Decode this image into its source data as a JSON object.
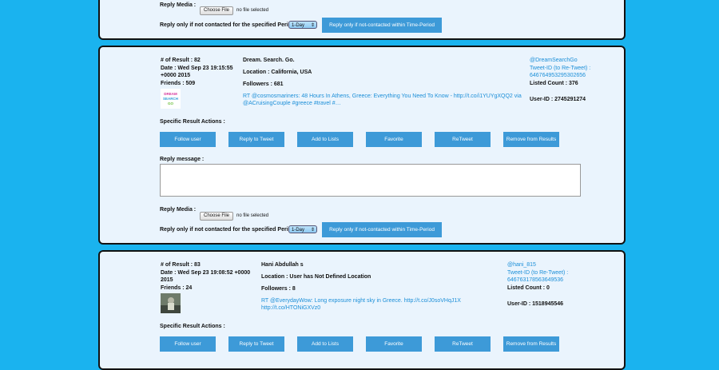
{
  "top": {
    "reply_media_label": "Reply Media :",
    "choose_file": "Choose File",
    "no_file": "no file selected",
    "period_label": "Reply only if not contacted for the specified Period :",
    "period_value": "1-Day",
    "period_button": "Reply only if not-contacted within Time-Period"
  },
  "results": [
    {
      "num": "# of Result : 82",
      "date_line1": "Date : Wed Sep 23 19:15:55",
      "date_line2": "+0000 2015",
      "friends": "Friends : 509",
      "avatar_text": "DREAM SEARCH GO",
      "name": "Dream. Search. Go.",
      "location": "Location : California, USA",
      "followers": "Followers : 681",
      "tweet_line1": "RT @cosmosmariners: 48 Hours In Athens, Greece: Everything You Need To Know - http://t.co/i1YUYgXQQ2 via",
      "tweet_line2": "@ACruisingCouple #greece #travel #…",
      "handle": "@DreamSearchGo",
      "tweet_id_label": "Tweet-ID (to Re-Tweet) :",
      "tweet_id": "646764953295302656",
      "listed": "Listed Count : 376",
      "user_id": "User-ID : 2745291274"
    },
    {
      "num": "# of Result : 83",
      "date_line1": "Date : Wed Sep 23 19:08:52 +0000",
      "date_line2": "2015",
      "friends": "Friends : 24",
      "name": "Hani Abdullah s",
      "location": "Location : User has Not Defined Location",
      "followers": "Followers : 8",
      "tweet_line1": "RT @EverydayWow: Long exposure night sky in Greece. http://t.co/J0soVHqJ1X",
      "tweet_line2": "http://t.co/HTONiGXVz0",
      "handle": "@hani_815",
      "tweet_id_label": "Tweet-ID (to Re-Tweet) :",
      "tweet_id": "646763178563649536",
      "listed": "Listed Count : 0",
      "user_id": "User-ID : 1518945546"
    }
  ],
  "actions_label": "Specific Result Actions :",
  "actions": {
    "follow": "Follow user",
    "reply": "Reply to Tweet",
    "lists": "Add to Lists",
    "favorite": "Favorite",
    "retweet": "ReTweet",
    "remove": "Remove from Results"
  },
  "reply_message_label": "Reply message :",
  "reply_media_label": "Reply Media :",
  "choose_file": "Choose File",
  "no_file": "no file selected",
  "period_label": "Reply only if not contacted for the specified Period :",
  "period_value": "1-Day",
  "period_button": "Reply only if not-contacted within Time-Period"
}
